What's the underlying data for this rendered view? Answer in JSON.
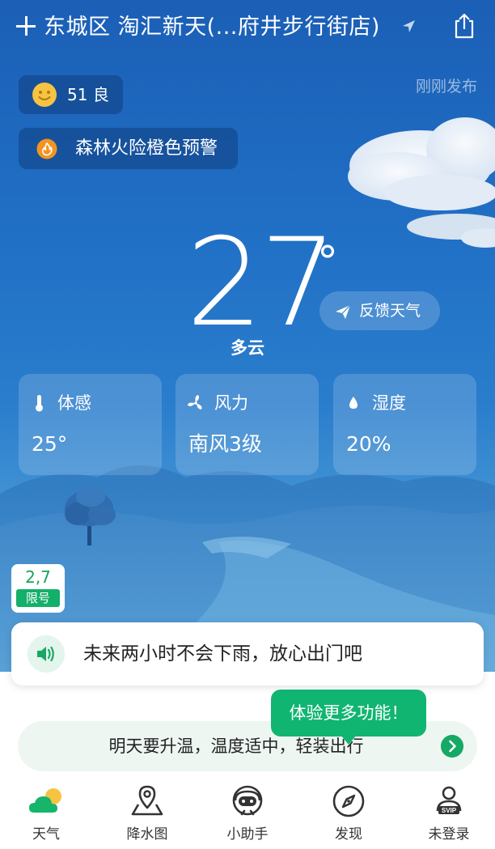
{
  "header": {
    "location": "东城区 淘汇新天(...府井步行街店)"
  },
  "air_quality": {
    "value": "51",
    "level": "良"
  },
  "publish_status": "刚刚发布",
  "alert": {
    "text": "森林火险橙色预警",
    "color": "#f29422"
  },
  "current": {
    "temperature": "27",
    "degree_symbol": "°",
    "condition": "多云"
  },
  "feedback_label": "反馈天气",
  "details": [
    {
      "label": "体感",
      "value": "25°",
      "icon": "thermometer-icon"
    },
    {
      "label": "风力",
      "value": "南风3级",
      "icon": "fan-icon"
    },
    {
      "label": "湿度",
      "value": "20%",
      "icon": "water-drop-icon"
    }
  ],
  "traffic_restriction": {
    "numbers": "2,7",
    "label": "限号"
  },
  "rain_forecast": "未来两小时不会下雨，放心出门吧",
  "tooltip": "体验更多功能！",
  "tip": "明天要升温，温度适中，轻装出行",
  "tabs": [
    {
      "label": "天气",
      "icon": "weather-icon",
      "active": true
    },
    {
      "label": "降水图",
      "icon": "map-pin-icon"
    },
    {
      "label": "小助手",
      "icon": "assistant-icon"
    },
    {
      "label": "发现",
      "icon": "compass-icon"
    },
    {
      "label": "未登录",
      "icon": "user-svip-icon"
    }
  ],
  "colors": {
    "accent_green": "#14b06a",
    "sky_top": "#1b5fb6",
    "sky_bottom": "#79b9e2"
  }
}
